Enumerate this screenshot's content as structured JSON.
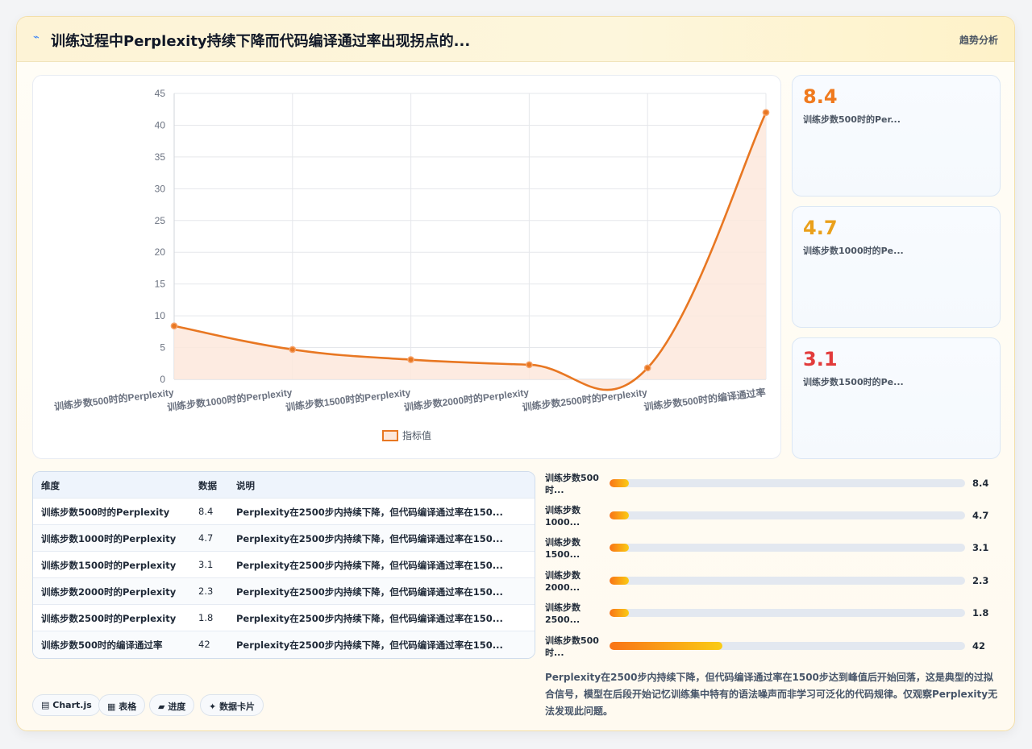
{
  "header": {
    "icon": "chart-line-icon",
    "title": "训练过程中Perplexity持续下降而代码编译通过率出现拐点的...",
    "tag": "趋势分析"
  },
  "chart_data": {
    "type": "line",
    "categories": [
      "训练步数500时的Perplexity",
      "训练步数1000时的Perplexity",
      "训练步数1500时的Perplexity",
      "训练步数2000时的Perplexity",
      "训练步数2500时的Perplexity",
      "训练步数500时的编译通过率"
    ],
    "series": [
      {
        "name": "指标值",
        "values": [
          8.4,
          4.7,
          3.1,
          2.3,
          1.8,
          42
        ]
      }
    ],
    "ylim": [
      0,
      45
    ],
    "yticks": [
      0,
      5,
      10,
      15,
      20,
      25,
      30,
      35,
      40,
      45
    ],
    "grid": true,
    "legend": "bottom",
    "color": "#e87722",
    "fill": "#fde8dc"
  },
  "stats": [
    {
      "value": "8.4",
      "label": "训练步数500时的Per...",
      "color": "#f07a1e"
    },
    {
      "value": "4.7",
      "label": "训练步数1000时的Pe...",
      "color": "#eaa01b"
    },
    {
      "value": "3.1",
      "label": "训练步数1500时的Pe...",
      "color": "#e23b3b"
    }
  ],
  "table": {
    "headers": [
      "维度",
      "数据",
      "说明"
    ],
    "rows": [
      [
        "训练步数500时的Perplexity",
        "8.4",
        "Perplexity在2500步内持续下降，但代码编译通过率在150..."
      ],
      [
        "训练步数1000时的Perplexity",
        "4.7",
        "Perplexity在2500步内持续下降，但代码编译通过率在150..."
      ],
      [
        "训练步数1500时的Perplexity",
        "3.1",
        "Perplexity在2500步内持续下降，但代码编译通过率在150..."
      ],
      [
        "训练步数2000时的Perplexity",
        "2.3",
        "Perplexity在2500步内持续下降，但代码编译通过率在150..."
      ],
      [
        "训练步数2500时的Perplexity",
        "1.8",
        "Perplexity在2500步内持续下降，但代码编译通过率在150..."
      ],
      [
        "训练步数500时的编译通过率",
        "42",
        "Perplexity在2500步内持续下降，但代码编译通过率在150..."
      ]
    ]
  },
  "bars": [
    {
      "label": "训练步数500时...",
      "value": "8.4",
      "level": 0.055
    },
    {
      "label": "训练步数1000...",
      "value": "4.7",
      "level": 0.055
    },
    {
      "label": "训练步数1500...",
      "value": "3.1",
      "level": 0.055
    },
    {
      "label": "训练步数2000...",
      "value": "2.3",
      "level": 0.055
    },
    {
      "label": "训练步数2500...",
      "value": "1.8",
      "level": 0.055
    },
    {
      "label": "训练步数500时...",
      "value": "42",
      "level": 0.317
    }
  ],
  "note": "Perplexity在2500步内持续下降，但代码编译通过率在1500步达到峰值后开始回落，这是典型的过拟合信号，模型在后段开始记忆训练集中特有的语法噪声而非学习可泛化的代码规律。仅观察Perplexity无法发现此问题。",
  "chips": [
    {
      "icon": "chart-icon",
      "glyph": "▤",
      "label": "Chart.js"
    },
    {
      "icon": "table-icon",
      "glyph": "▦",
      "label": "表格"
    },
    {
      "icon": "progress-icon",
      "glyph": "▰",
      "label": "进度"
    },
    {
      "icon": "card-icon",
      "glyph": "✦",
      "label": "数据卡片"
    }
  ]
}
